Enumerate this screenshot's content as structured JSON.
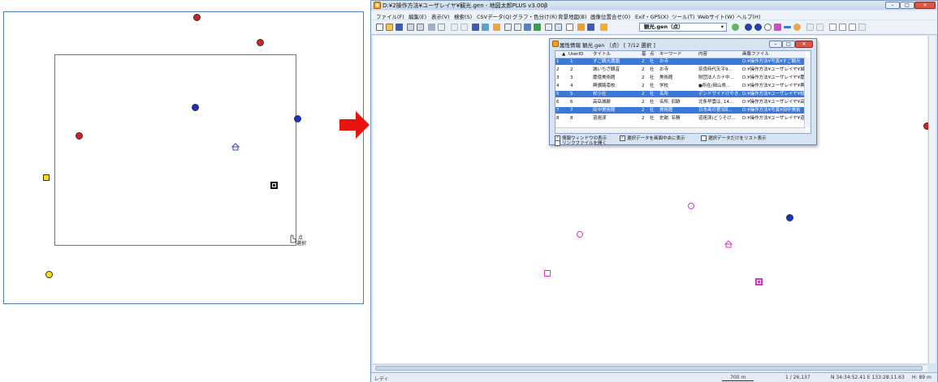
{
  "left_panel": {
    "cursor_label_1": "点",
    "cursor_label_2": "選択",
    "icon_temple": "temple-map-symbol",
    "icon_museum": "museum-map-symbol"
  },
  "app": {
    "title": "D:¥2操作方法¥ユーザレイヤ¥観光.gen - 地図太郎PLUS v3.00β",
    "menu": [
      "ファイル(F)",
      "編集(E)",
      "表示(V)",
      "検索(S)",
      "CSVデータ(Q)",
      "グラフ・色分け(R)",
      "背景地図(B)",
      "画像位置合せ(O)",
      "Exif・GPS(X)",
      "ツール(T)",
      "Webサイト(W)",
      "ヘルプ(H)"
    ],
    "layer_select": "観光.gen（点）",
    "status": {
      "ready": "レディ",
      "scale": "700 m",
      "ratio": "1 / 26,137",
      "coords": "N 34:34:52.41  E 133:28:11.63",
      "height": "H: 89 m"
    }
  },
  "dialog": {
    "title": "属性情報  観光.gen （点）  [ 7/12 選択 ]",
    "headers": [
      "UserID",
      "タイトル",
      "基",
      "点",
      "キーワード",
      "内容",
      "画像ファイル"
    ],
    "rows": [
      {
        "no": "1",
        "id": "1",
        "title": "すご観光農園",
        "k": "2",
        "t": "社",
        "kw": "お寺",
        "content": "",
        "img": "D:¥操作方法¥写真¥すご観光",
        "sel": true
      },
      {
        "no": "2",
        "id": "2",
        "title": "城いちざ観音",
        "k": "2",
        "t": "社",
        "kw": "お寺",
        "content": "奈良時代天平9...",
        "img": "D:¥操作方法¥ユーザレイヤ¥城",
        "sel": false
      },
      {
        "no": "3",
        "id": "3",
        "title": "慶徳美術館",
        "k": "2",
        "t": "社",
        "kw": "美術館",
        "content": "財団法人カナ中...",
        "img": "D:¥操作方法¥ユーザレイヤ¥慶",
        "sel": false
      },
      {
        "no": "4",
        "id": "4",
        "title": "興讃路南校",
        "k": "2",
        "t": "社",
        "kw": "学校",
        "content": "●所在/岡山県...",
        "img": "D:¥操作方法¥ユーザレイヤ¥興",
        "sel": false
      },
      {
        "no": "5",
        "id": "5",
        "title": "杖小社",
        "k": "2",
        "t": "社",
        "kw": "名所",
        "content": "デンドサイドけやき...",
        "img": "D:¥操作方法¥ユーザレイヤ¥杖",
        "sel": true
      },
      {
        "no": "6",
        "id": "6",
        "title": "高岳城跡",
        "k": "2",
        "t": "社",
        "kw": "名所, 旧跡",
        "content": "北条早雲は, 14...",
        "img": "D:¥操作方法¥ユーザレイヤ¥高",
        "sel": false
      },
      {
        "no": "7",
        "id": "7",
        "title": "田中美術館",
        "k": "2",
        "t": "社",
        "kw": "美術館",
        "content": "日本画の第3回...",
        "img": "D:¥操作方法¥写真¥田中美術",
        "sel": true
      },
      {
        "no": "8",
        "id": "8",
        "title": "道祖渓",
        "k": "2",
        "t": "社",
        "kw": "史跡, 名勝",
        "content": "道祖渓(どうそけ...",
        "img": "D:¥操作方法¥ユーザレイヤ¥道",
        "sel": false
      }
    ],
    "check_info_window": "情報ウィンドウの表示",
    "check_center": "選択データを画面中央に表示",
    "check_list_only": "選択データだけをリスト表示",
    "check_link_file": "リンクファイルを開く"
  },
  "colors": {
    "accent": "#3b78d8",
    "marker_red": "#d42020",
    "marker_blue": "#1a2fd0",
    "marker_magenta": "#d833c8",
    "arrow": "#e8120f"
  }
}
